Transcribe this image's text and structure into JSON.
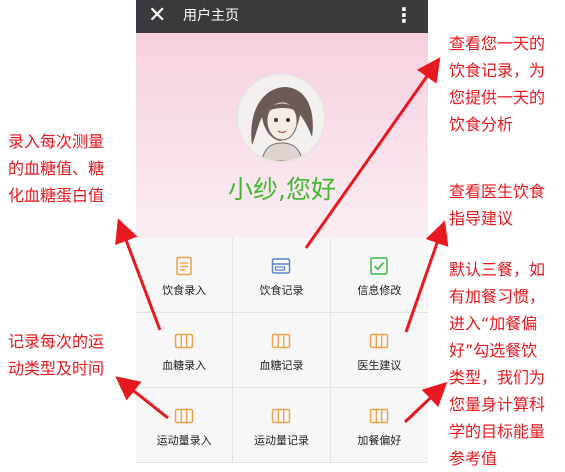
{
  "titlebar": {
    "close_icon": "close-icon",
    "title": "用户主页",
    "more_icon": "more-vertical-icon"
  },
  "profile": {
    "greeting": "小纱,您好"
  },
  "menu": [
    {
      "label": "饮食录入",
      "icon": "document-icon",
      "color": "#f0a24c"
    },
    {
      "label": "饮食记录",
      "icon": "card-icon",
      "color": "#5a86c8"
    },
    {
      "label": "信息修改",
      "icon": "checkbox-icon",
      "color": "#3cb94a"
    },
    {
      "label": "血糖录入",
      "icon": "columns-icon",
      "color": "#f0a24c"
    },
    {
      "label": "血糖记录",
      "icon": "columns-icon",
      "color": "#f0a24c"
    },
    {
      "label": "医生建议",
      "icon": "columns-icon",
      "color": "#f0a24c"
    },
    {
      "label": "运动量录入",
      "icon": "columns-icon",
      "color": "#f0a24c"
    },
    {
      "label": "运动量记录",
      "icon": "columns-icon",
      "color": "#f0a24c"
    },
    {
      "label": "加餐偏好",
      "icon": "columns-icon",
      "color": "#f0a24c"
    }
  ],
  "annotations": {
    "blood_sugar_entry": [
      "录入每次测量",
      "的血糖值、糖",
      "化血糖蛋白值"
    ],
    "exercise_entry": [
      "记录每次的运",
      "动类型及时间"
    ],
    "diet_record": [
      "查看您一天的",
      "饮食记录，为",
      "您提供一天的",
      "饮食分析"
    ],
    "doctor_advice": [
      "查看医生饮食",
      "指导建议"
    ],
    "meal_preference": [
      "默认三餐，如",
      "有加餐习惯，",
      "进入“加餐偏",
      "好”勾选餐饮",
      "类型，我们为",
      "您量身计算科",
      "学的目标能量",
      "参考值"
    ]
  },
  "colors": {
    "annotation": "#e8181f",
    "greeting": "#41b82f",
    "titlebar": "#393a3f"
  }
}
